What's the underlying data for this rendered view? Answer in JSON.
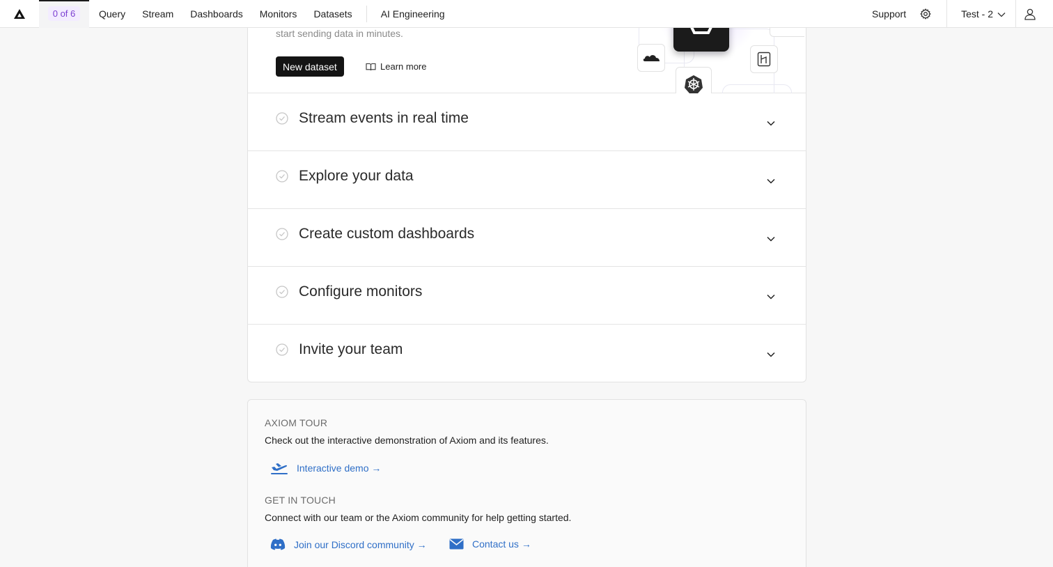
{
  "nav": {
    "progress": "0 of 6",
    "items": [
      "Query",
      "Stream",
      "Dashboards",
      "Monitors",
      "Datasets"
    ],
    "ai": "AI Engineering",
    "support": "Support",
    "org": "Test - 2"
  },
  "hero": {
    "text": "start sending data in minutes.",
    "new_dataset": "New dataset",
    "learn_more": "Learn more"
  },
  "steps": [
    "Stream events in real time",
    "Explore your data",
    "Create custom dashboards",
    "Configure monitors",
    "Invite your team"
  ],
  "resources": {
    "tour_heading": "AXIOM TOUR",
    "tour_desc": "Check out the interactive demonstration of Axiom and its features.",
    "demo_link": "Interactive demo →",
    "touch_heading": "GET IN TOUCH",
    "touch_desc": "Connect with our team or the Axiom community for help getting started.",
    "discord_link": "Join our Discord community →",
    "contact_link": "Contact us →"
  },
  "colors": {
    "accent": "#7b3fd1",
    "link": "#2f6fc7",
    "primary_button": "#141414"
  }
}
